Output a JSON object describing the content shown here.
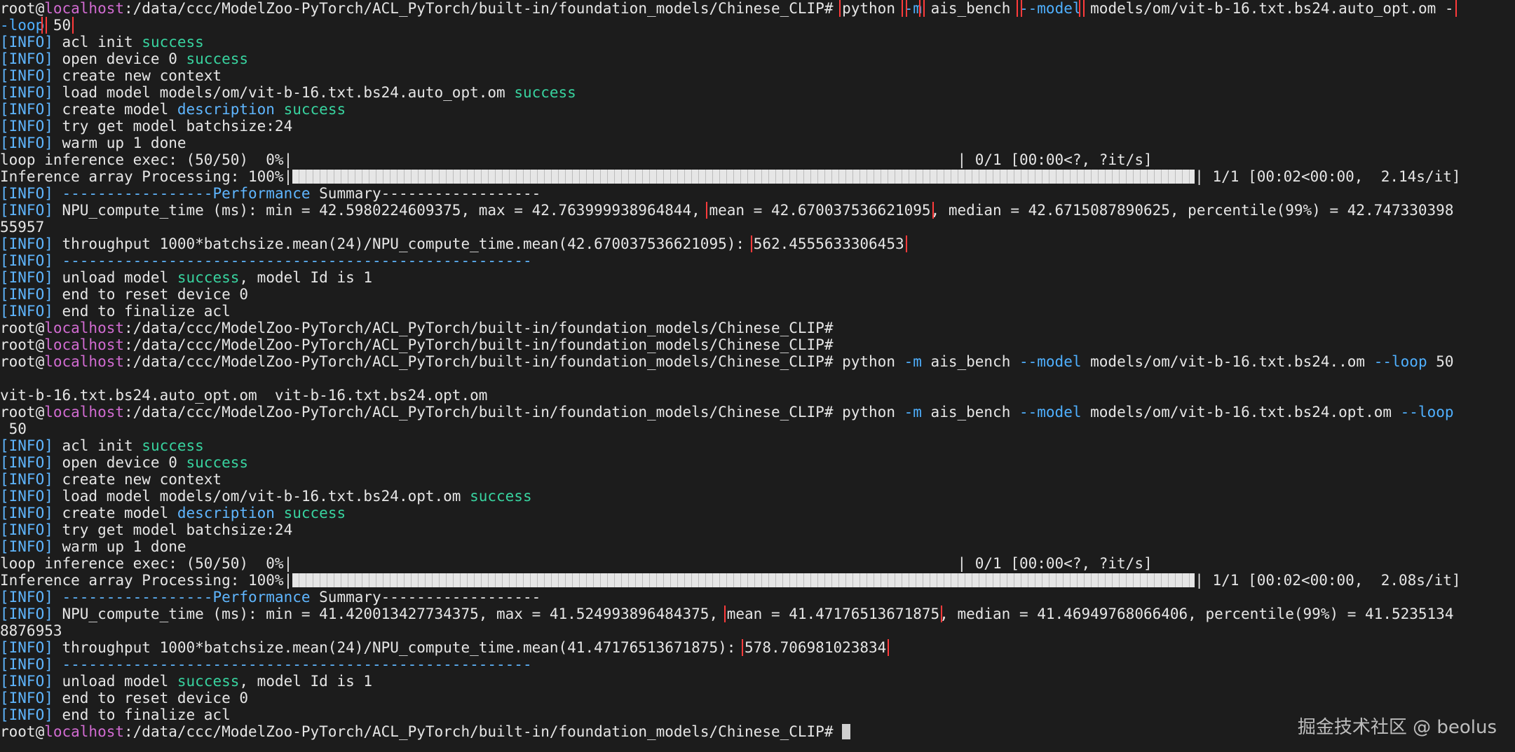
{
  "terminal": {
    "lines": [
      [
        {
          "t": "root@",
          "c": "default"
        },
        {
          "t": "localhost",
          "c": "host"
        },
        {
          "t": ":/data/ccc/ModelZoo-PyTorch/ACL_PyTorch/built-in/foundation_models/Chinese_CLIP# ",
          "c": "default"
        },
        {
          "t": "python ",
          "c": "default",
          "hl": true
        },
        {
          "t": "-m",
          "c": "flag",
          "hl": true
        },
        {
          "t": " ais_bench ",
          "c": "default",
          "hl": true
        },
        {
          "t": "--model",
          "c": "flag",
          "hl": true
        },
        {
          "t": " models/om/vit-b-16.txt.bs24.auto_opt.om -",
          "c": "default",
          "hl": true
        }
      ],
      [
        {
          "t": "-loop",
          "c": "flag",
          "hl": true
        },
        {
          "t": " 50",
          "c": "default",
          "hl": true
        }
      ],
      [
        {
          "t": "[INFO]",
          "c": "info"
        },
        {
          "t": " acl init ",
          "c": "default"
        },
        {
          "t": "success",
          "c": "success"
        }
      ],
      [
        {
          "t": "[INFO]",
          "c": "info"
        },
        {
          "t": " open device 0 ",
          "c": "default"
        },
        {
          "t": "success",
          "c": "success"
        }
      ],
      [
        {
          "t": "[INFO]",
          "c": "info"
        },
        {
          "t": " create new context",
          "c": "default"
        }
      ],
      [
        {
          "t": "[INFO]",
          "c": "info"
        },
        {
          "t": " load model models/om/vit-b-16.txt.bs24.auto_opt.om ",
          "c": "default"
        },
        {
          "t": "success",
          "c": "success"
        }
      ],
      [
        {
          "t": "[INFO]",
          "c": "info"
        },
        {
          "t": " create model ",
          "c": "default"
        },
        {
          "t": "description",
          "c": "info"
        },
        {
          "t": " ",
          "c": "default"
        },
        {
          "t": "success",
          "c": "success"
        }
      ],
      [
        {
          "t": "[INFO]",
          "c": "info"
        },
        {
          "t": " try get model batchsize:24",
          "c": "default"
        }
      ],
      [
        {
          "t": "[INFO]",
          "c": "info"
        },
        {
          "t": " warm up 1 done",
          "c": "default"
        }
      ],
      [
        {
          "t": "loop inference exec: (50/50)  0%|",
          "c": "default"
        },
        {
          "t": "                                                                           ",
          "c": "default"
        },
        {
          "t": "| 0/1 [00:00<?, ?it/s]",
          "c": "default"
        }
      ],
      [
        {
          "t": "Inference array Processing: 100%|",
          "c": "default"
        },
        {
          "bar": true,
          "value": 1.0,
          "cells": 99
        },
        {
          "t": "| 1/1 [00:02<00:00,  2.14s/it]",
          "c": "default"
        }
      ],
      [
        {
          "t": "[INFO]",
          "c": "info"
        },
        {
          "t": " -----------------",
          "c": "perf"
        },
        {
          "t": "Performance",
          "c": "perf"
        },
        {
          "t": " Summary------------------",
          "c": "default"
        }
      ],
      [
        {
          "t": "[INFO]",
          "c": "info"
        },
        {
          "t": " NPU_compute_time (ms): min = 42.5980224609375, max = 42.763999938964844, ",
          "c": "default"
        },
        {
          "t": "mean = 42.670037536621095",
          "c": "default",
          "hl": true
        },
        {
          "t": ", median = 42.6715087890625, percentile(99%) = 42.747330398",
          "c": "default"
        }
      ],
      [
        {
          "t": "55957",
          "c": "default"
        }
      ],
      [
        {
          "t": "[INFO]",
          "c": "info"
        },
        {
          "t": " throughput 1000*batchsize.mean(24)/NPU_compute_time.mean(42.670037536621095): ",
          "c": "default"
        },
        {
          "t": "562.4555633306453",
          "c": "default",
          "hl": true
        }
      ],
      [
        {
          "t": "[INFO]",
          "c": "info"
        },
        {
          "t": " -----------------------------------------------------",
          "c": "perf"
        }
      ],
      [
        {
          "t": "[INFO]",
          "c": "info"
        },
        {
          "t": " unload model ",
          "c": "default"
        },
        {
          "t": "success",
          "c": "success"
        },
        {
          "t": ", model Id is 1",
          "c": "default"
        }
      ],
      [
        {
          "t": "[INFO]",
          "c": "info"
        },
        {
          "t": " end to reset device 0",
          "c": "default"
        }
      ],
      [
        {
          "t": "[INFO]",
          "c": "info"
        },
        {
          "t": " end to finalize acl",
          "c": "default"
        }
      ],
      [
        {
          "t": "root@",
          "c": "default"
        },
        {
          "t": "localhost",
          "c": "host"
        },
        {
          "t": ":/data/ccc/ModelZoo-PyTorch/ACL_PyTorch/built-in/foundation_models/Chinese_CLIP#",
          "c": "default"
        }
      ],
      [
        {
          "t": "root@",
          "c": "default"
        },
        {
          "t": "localhost",
          "c": "host"
        },
        {
          "t": ":/data/ccc/ModelZoo-PyTorch/ACL_PyTorch/built-in/foundation_models/Chinese_CLIP#",
          "c": "default"
        }
      ],
      [
        {
          "t": "root@",
          "c": "default"
        },
        {
          "t": "localhost",
          "c": "host"
        },
        {
          "t": ":/data/ccc/ModelZoo-PyTorch/ACL_PyTorch/built-in/foundation_models/Chinese_CLIP# python ",
          "c": "default"
        },
        {
          "t": "-m",
          "c": "flag"
        },
        {
          "t": " ais_bench ",
          "c": "default"
        },
        {
          "t": "--model",
          "c": "flag"
        },
        {
          "t": " models/om/vit-b-16.txt.bs24..om ",
          "c": "default"
        },
        {
          "t": "--loop",
          "c": "flag"
        },
        {
          "t": " 50",
          "c": "default"
        }
      ],
      [
        {
          "t": "",
          "c": "default"
        }
      ],
      [
        {
          "t": "vit-b-16.txt.bs24.auto_opt.om  vit-b-16.txt.bs24.opt.om",
          "c": "default"
        }
      ],
      [
        {
          "t": "root@",
          "c": "default"
        },
        {
          "t": "localhost",
          "c": "host"
        },
        {
          "t": ":/data/ccc/ModelZoo-PyTorch/ACL_PyTorch/built-in/foundation_models/Chinese_CLIP# python ",
          "c": "default"
        },
        {
          "t": "-m",
          "c": "flag"
        },
        {
          "t": " ais_bench ",
          "c": "default"
        },
        {
          "t": "--model",
          "c": "flag"
        },
        {
          "t": " models/om/vit-b-16.txt.bs24.opt.om ",
          "c": "default"
        },
        {
          "t": "--loop",
          "c": "flag"
        }
      ],
      [
        {
          "t": " 50",
          "c": "default"
        }
      ],
      [
        {
          "t": "[INFO]",
          "c": "info"
        },
        {
          "t": " acl init ",
          "c": "default"
        },
        {
          "t": "success",
          "c": "success"
        }
      ],
      [
        {
          "t": "[INFO]",
          "c": "info"
        },
        {
          "t": " open device 0 ",
          "c": "default"
        },
        {
          "t": "success",
          "c": "success"
        }
      ],
      [
        {
          "t": "[INFO]",
          "c": "info"
        },
        {
          "t": " create new context",
          "c": "default"
        }
      ],
      [
        {
          "t": "[INFO]",
          "c": "info"
        },
        {
          "t": " load model models/om/vit-b-16.txt.bs24.opt.om ",
          "c": "default"
        },
        {
          "t": "success",
          "c": "success"
        }
      ],
      [
        {
          "t": "[INFO]",
          "c": "info"
        },
        {
          "t": " create model ",
          "c": "default"
        },
        {
          "t": "description",
          "c": "info"
        },
        {
          "t": " ",
          "c": "default"
        },
        {
          "t": "success",
          "c": "success"
        }
      ],
      [
        {
          "t": "[INFO]",
          "c": "info"
        },
        {
          "t": " try get model batchsize:24",
          "c": "default"
        }
      ],
      [
        {
          "t": "[INFO]",
          "c": "info"
        },
        {
          "t": " warm up 1 done",
          "c": "default"
        }
      ],
      [
        {
          "t": "loop inference exec: (50/50)  0%|",
          "c": "default"
        },
        {
          "t": "                                                                           ",
          "c": "default"
        },
        {
          "t": "| 0/1 [00:00<?, ?it/s]",
          "c": "default"
        }
      ],
      [
        {
          "t": "Inference array Processing: 100%|",
          "c": "default"
        },
        {
          "bar": true,
          "value": 1.0,
          "cells": 99
        },
        {
          "t": "| 1/1 [00:02<00:00,  2.08s/it]",
          "c": "default"
        }
      ],
      [
        {
          "t": "[INFO]",
          "c": "info"
        },
        {
          "t": " -----------------",
          "c": "perf"
        },
        {
          "t": "Performance",
          "c": "perf"
        },
        {
          "t": " Summary------------------",
          "c": "default"
        }
      ],
      [
        {
          "t": "[INFO]",
          "c": "info"
        },
        {
          "t": " NPU_compute_time (ms): min = 41.420013427734375, max = 41.524993896484375, ",
          "c": "default"
        },
        {
          "t": "mean = 41.47176513671875",
          "c": "default",
          "hl": true
        },
        {
          "t": ", median = 41.46949768066406, percentile(99%) = 41.5235134",
          "c": "default"
        }
      ],
      [
        {
          "t": "8876953",
          "c": "default"
        }
      ],
      [
        {
          "t": "[INFO]",
          "c": "info"
        },
        {
          "t": " throughput 1000*batchsize.mean(24)/NPU_compute_time.mean(41.47176513671875): ",
          "c": "default"
        },
        {
          "t": "578.706981023834",
          "c": "default",
          "hl": true
        }
      ],
      [
        {
          "t": "[INFO]",
          "c": "info"
        },
        {
          "t": " -----------------------------------------------------",
          "c": "perf"
        }
      ],
      [
        {
          "t": "[INFO]",
          "c": "info"
        },
        {
          "t": " unload model ",
          "c": "default"
        },
        {
          "t": "success",
          "c": "success"
        },
        {
          "t": ", model Id is 1",
          "c": "default"
        }
      ],
      [
        {
          "t": "[INFO]",
          "c": "info"
        },
        {
          "t": " end to reset device 0",
          "c": "default"
        }
      ],
      [
        {
          "t": "[INFO]",
          "c": "info"
        },
        {
          "t": " end to finalize acl",
          "c": "default"
        }
      ],
      [
        {
          "t": "root@",
          "c": "default"
        },
        {
          "t": "localhost",
          "c": "host"
        },
        {
          "t": ":/data/ccc/ModelZoo-PyTorch/ACL_PyTorch/built-in/foundation_models/Chinese_CLIP# ",
          "c": "default"
        },
        {
          "cursor": true
        }
      ]
    ],
    "colors": {
      "background": "#1c1c1c",
      "text": "#e6e6e6",
      "host": "#d16bd1",
      "info": "#5fb6ff",
      "success": "#38d39f",
      "highlight_box": "#ff3b3b"
    }
  },
  "watermark": "掘金技术社区 @ beolus"
}
